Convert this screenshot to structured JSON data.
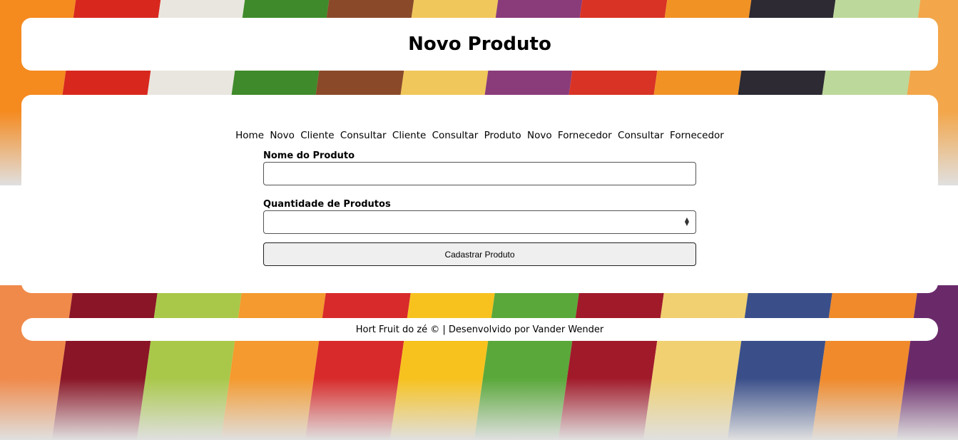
{
  "colors": {
    "top_stripes": [
      "#f58a1f",
      "#d8281e",
      "#e9e6df",
      "#3f8a2a",
      "#8a4a2a",
      "#f0c75a",
      "#8a3c7a",
      "#d93325",
      "#f19224",
      "#2d2a33",
      "#bcd89a",
      "#f3a64a"
    ],
    "bottom_stripes": [
      "#f08a4a",
      "#8a1526",
      "#a9c84a",
      "#f49a2e",
      "#d82a2a",
      "#f7c21e",
      "#5aa83a",
      "#a11a2a",
      "#f0d070",
      "#3a4f8a",
      "#f08a2a",
      "#6a2a6a"
    ]
  },
  "header": {
    "title": "Novo Produto"
  },
  "nav": {
    "items": [
      "Home",
      "Novo",
      "Cliente",
      "Consultar",
      "Cliente",
      "Consultar",
      "Produto",
      "Novo",
      "Fornecedor",
      "Consultar",
      "Fornecedor"
    ]
  },
  "form": {
    "name_label": "Nome do Produto",
    "name_value": "",
    "qty_label": "Quantidade de Produtos",
    "qty_value": "",
    "submit_label": "Cadastrar Produto"
  },
  "footer": {
    "text": "Hort Fruit do zé © | Desenvolvido por Vander Wender"
  }
}
